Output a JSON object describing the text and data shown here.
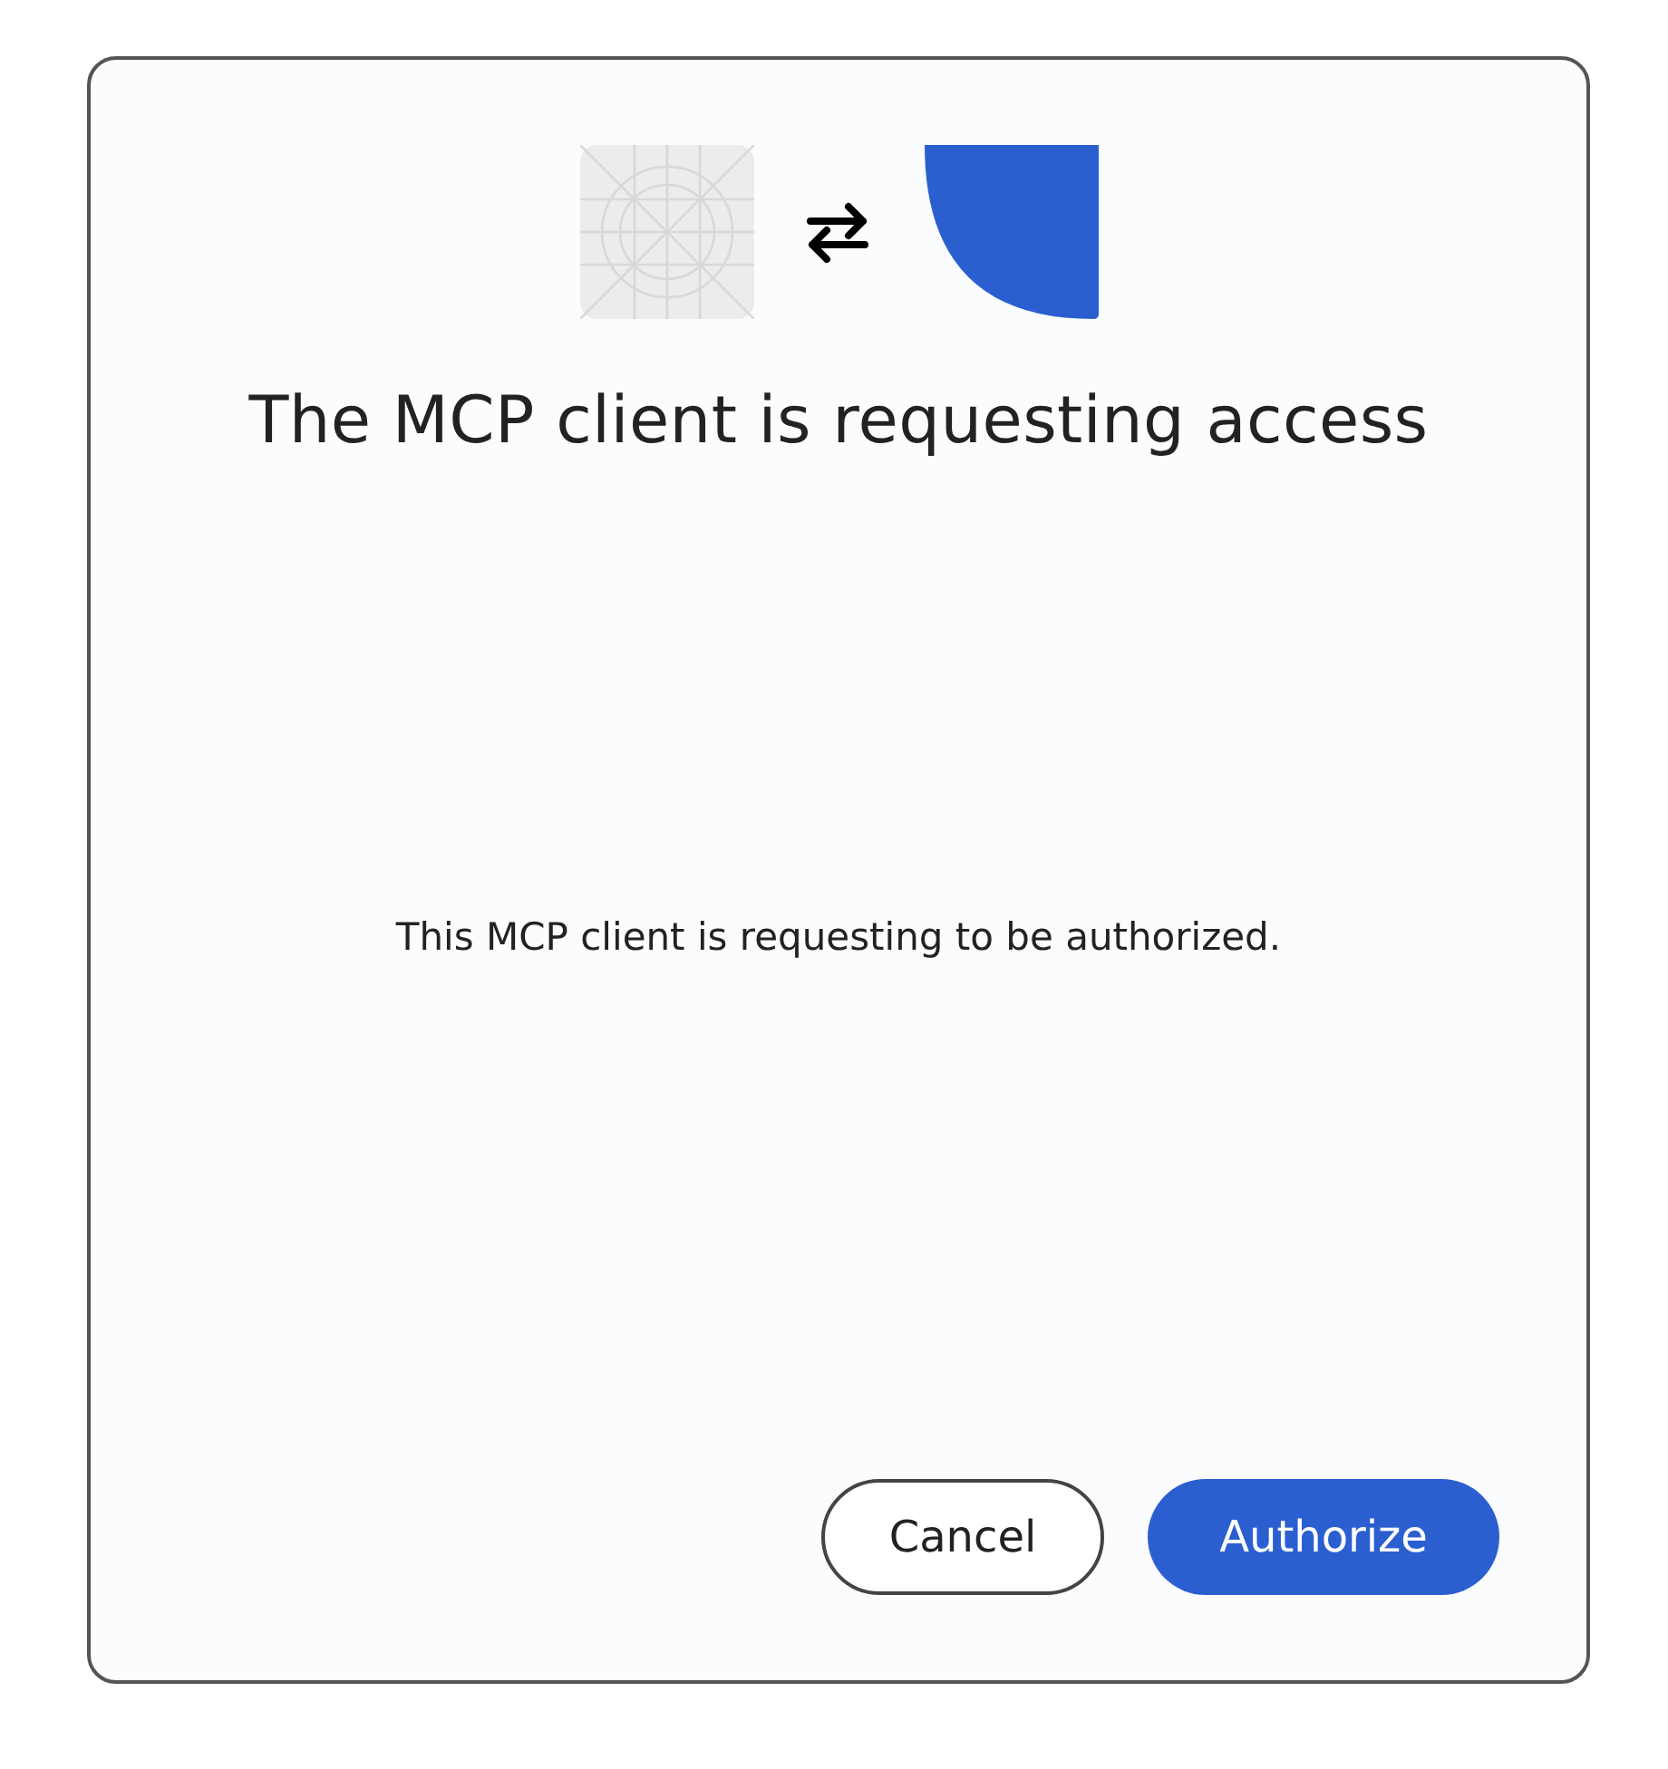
{
  "dialog": {
    "title": "The MCP client is requesting access",
    "message": "This MCP client is requesting to be authorized.",
    "buttons": [
      {
        "label": "Cancel",
        "kind": "secondary"
      },
      {
        "label": "Authorize",
        "kind": "primary"
      }
    ]
  }
}
